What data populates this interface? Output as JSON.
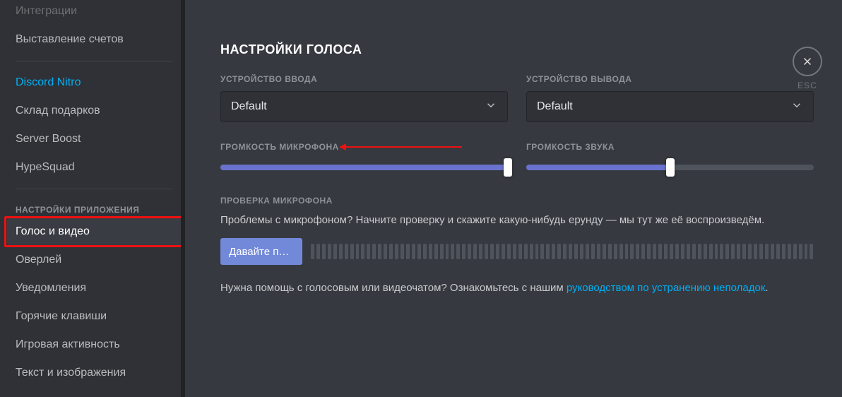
{
  "sidebar": {
    "items_top": [
      {
        "label": "Интеграции"
      },
      {
        "label": "Выставление счетов"
      }
    ],
    "items_nitro": [
      {
        "label": "Discord Nitro",
        "nitro": true
      },
      {
        "label": "Склад подарков"
      },
      {
        "label": "Server Boost"
      },
      {
        "label": "HypeSquad"
      }
    ],
    "app_header": "НАСТРОЙКИ ПРИЛОЖЕНИЯ",
    "items_app": [
      {
        "label": "Голос и видео",
        "active": true
      },
      {
        "label": "Оверлей"
      },
      {
        "label": "Уведомления"
      },
      {
        "label": "Горячие клавиши"
      },
      {
        "label": "Игровая активность"
      },
      {
        "label": "Текст и изображения"
      }
    ]
  },
  "main": {
    "title": "НАСТРОЙКИ ГОЛОСА",
    "input_device_label": "УСТРОЙСТВО ВВОДА",
    "output_device_label": "УСТРОЙСТВО ВЫВОДА",
    "input_device_value": "Default",
    "output_device_value": "Default",
    "mic_volume_label": "ГРОМКОСТЬ МИКРОФОНА",
    "out_volume_label": "ГРОМКОСТЬ ЗВУКА",
    "mic_volume_pct": 100,
    "out_volume_pct": 50,
    "mic_check_header": "ПРОВЕРКА МИКРОФОНА",
    "mic_check_desc": "Проблемы с микрофоном? Начните проверку и скажите какую-нибудь ерунду — мы тут же её воспроизведём.",
    "mic_test_button": "Давайте пр…",
    "help_prefix": "Нужна помощь с голосовым или видеочатом? Ознакомьтесь с нашим ",
    "help_link": "руководством по устранению неполадок",
    "help_suffix": "."
  },
  "close": {
    "esc": "ESC"
  }
}
